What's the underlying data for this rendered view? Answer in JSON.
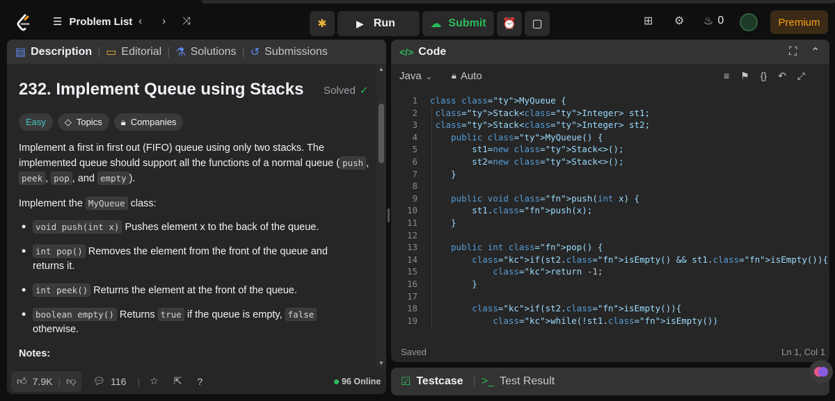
{
  "topbar": {
    "problem_list": "Problem List",
    "run": "Run",
    "submit": "Submit",
    "streak_count": "0",
    "premium": "Premium"
  },
  "left_tabs": [
    "Description",
    "Editorial",
    "Solutions",
    "Submissions"
  ],
  "problem": {
    "title": "232. Implement Queue using Stacks",
    "status": "Solved",
    "difficulty": "Easy",
    "tag_topics": "Topics",
    "tag_companies": "Companies",
    "intro_1": "Implement a first in first out (FIFO) queue using only two stacks. The implemented queue should support all the functions of a normal queue (",
    "ops": [
      "push",
      "peek",
      "pop",
      "empty"
    ],
    "intro_end": ").",
    "implement_pre": "Implement the ",
    "implement_code": "MyQueue",
    "implement_post": " class:",
    "methods": [
      {
        "sig": "void push(int x)",
        "text": " Pushes element x to the back of the queue."
      },
      {
        "sig": "int pop()",
        "text": " Removes the element from the front of the queue and returns it."
      },
      {
        "sig": "int peek()",
        "text": " Returns the element at the front of the queue."
      },
      {
        "sig": "boolean empty()",
        "text": " Returns ",
        "code2": "true",
        "text2": " if the queue is empty, ",
        "code3": "false",
        "text3": " otherwise."
      }
    ],
    "notes": "Notes:"
  },
  "left_footer": {
    "likes": "7.9K",
    "comments": "116",
    "online": "96 Online"
  },
  "code_panel": {
    "title": "Code",
    "language": "Java",
    "mode": "Auto",
    "saved": "Saved",
    "cursor": "Ln 1, Col 1"
  },
  "code_lines": [
    "class MyQueue {",
    " Stack<Integer> st1;",
    " Stack<Integer> st2;",
    "    public MyQueue() {",
    "        st1=new Stack<>();",
    "        st2=new Stack<>();",
    "    }",
    "",
    "    public void push(int x) {",
    "        st1.push(x);",
    "    }",
    "",
    "    public int pop() {",
    "        if(st2.isEmpty() && st1.isEmpty()){",
    "            return -1;",
    "        }",
    "",
    "        if(st2.isEmpty()){",
    "            while(!st1.isEmpty())"
  ],
  "bottom_tabs": [
    "Testcase",
    "Test Result"
  ],
  "colors": {
    "accent_green": "#2cbb5d",
    "easy": "#46c6c2",
    "premium": "#ffa116",
    "tab_blue": "#5a8dee"
  }
}
